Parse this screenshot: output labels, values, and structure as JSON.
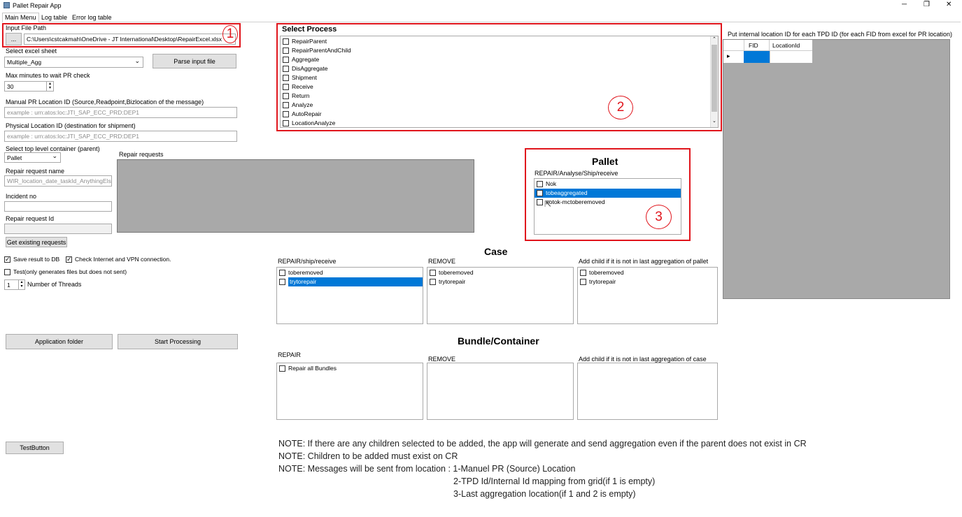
{
  "window": {
    "title": "Pallet Repair App",
    "minimize": "─",
    "restore": "❐",
    "close": "✕"
  },
  "tabs": [
    {
      "label": "Main Menu"
    },
    {
      "label": "Log table"
    },
    {
      "label": "Error log table"
    }
  ],
  "left": {
    "input_file_label": "Input File Path",
    "browse_label": "...",
    "input_file_value": "C:\\Users\\cstcakmah\\OneDrive - JT International\\Desktop\\RepairExcel.xlsx",
    "excel_sheet_label": "Select excel sheet",
    "excel_sheet_value": "Multiple_Agg",
    "parse_button": "Parse input file",
    "max_minutes_label": "Max minutes to wait PR check",
    "max_minutes_value": "30",
    "manual_pr_label": "Manual PR Location ID (Source,Readpoint,Bizlocation of the message)",
    "manual_pr_placeholder": "example : urn:atos:loc:JTI_SAP_ECC_PRD:DEP1",
    "physical_label": "Physical Location ID (destination for shipment)",
    "physical_placeholder": "example : urn:atos:loc:JTI_SAP_ECC_PRD:DEP1",
    "top_container_label": "Select top level container (parent)",
    "top_container_value": "Pallet",
    "repair_requests_label": "Repair requests",
    "repair_name_label": "Repair request name",
    "repair_name_placeholder": "WIR_location_date_taskId_AnythingElse",
    "incident_label": "Incident no",
    "repair_id_label": "Repair request Id",
    "get_existing_button": "Get existing requests",
    "save_db_label": "Save result to DB",
    "check_internet_label": "Check Internet and VPN connection.",
    "test_label": "Test(only generates files but does not sent)",
    "threads_value": "1",
    "threads_label": "Number of Threads",
    "app_folder_button": "Application folder",
    "start_button": "Start Processing",
    "test_button": "TestButton"
  },
  "select_process": {
    "title": "Select Process",
    "items": [
      "RepairParent",
      "RepairParentAndChild",
      "Aggregate",
      "DisAggregate",
      "Shipment",
      "Receive",
      "Return",
      "Analyze",
      "AutoRepair",
      "LocationAnalyze"
    ]
  },
  "pallet": {
    "title": "Pallet",
    "sub": "REPAIR/Analyse/Ship/receive",
    "items": [
      {
        "label": "Nok",
        "checked": false,
        "selected": false
      },
      {
        "label": "tobeaggregated",
        "checked": true,
        "selected": true
      },
      {
        "label": "notok-mctoberemoved",
        "checked": false,
        "selected": false
      }
    ]
  },
  "case": {
    "title": "Case",
    "col1_label": "REPAIR/ship/receive",
    "col1_items": [
      {
        "label": "toberemoved",
        "selected": false
      },
      {
        "label": "trytorepair",
        "selected": true
      }
    ],
    "col2_label": "REMOVE",
    "col2_items": [
      {
        "label": "toberemoved"
      },
      {
        "label": "trytorepair"
      }
    ],
    "col3_label": "Add child if it is not in last aggregation of pallet",
    "col3_items": [
      {
        "label": "toberemoved"
      },
      {
        "label": "trytorepair"
      }
    ]
  },
  "bundle": {
    "title": "Bundle/Container",
    "col1_label": "REPAIR",
    "col1_items": [
      {
        "label": "Repair all Bundles"
      }
    ],
    "col2_label": "REMOVE",
    "col3_label": "Add child if it is not in last aggregation of case"
  },
  "grid": {
    "label": "Put internal location ID for each TPD ID (for each FID from excel for PR location)",
    "col1": "FID",
    "col2": "LocationId",
    "row_marker": "▸"
  },
  "notes": {
    "n1": "NOTE: If there are any children selected to be added, the app will generate and send aggregation even if the parent does not exist in CR",
    "n2": "NOTE: Children to be added must exist on CR",
    "n3": "NOTE: Messages will be sent from location : 1-Manuel PR (Source) Location",
    "n4": "2-TPD Id/Internal Id mapping from grid(if 1 is empty)",
    "n5": "3-Last aggregation location(if 1 and 2 is empty)"
  },
  "annotations": {
    "a1": "1",
    "a2": "2",
    "a3": "3"
  },
  "colors": {
    "accent": "#0078d7",
    "highlight": "#e0151c",
    "gray_panel": "#a9a9a9"
  }
}
